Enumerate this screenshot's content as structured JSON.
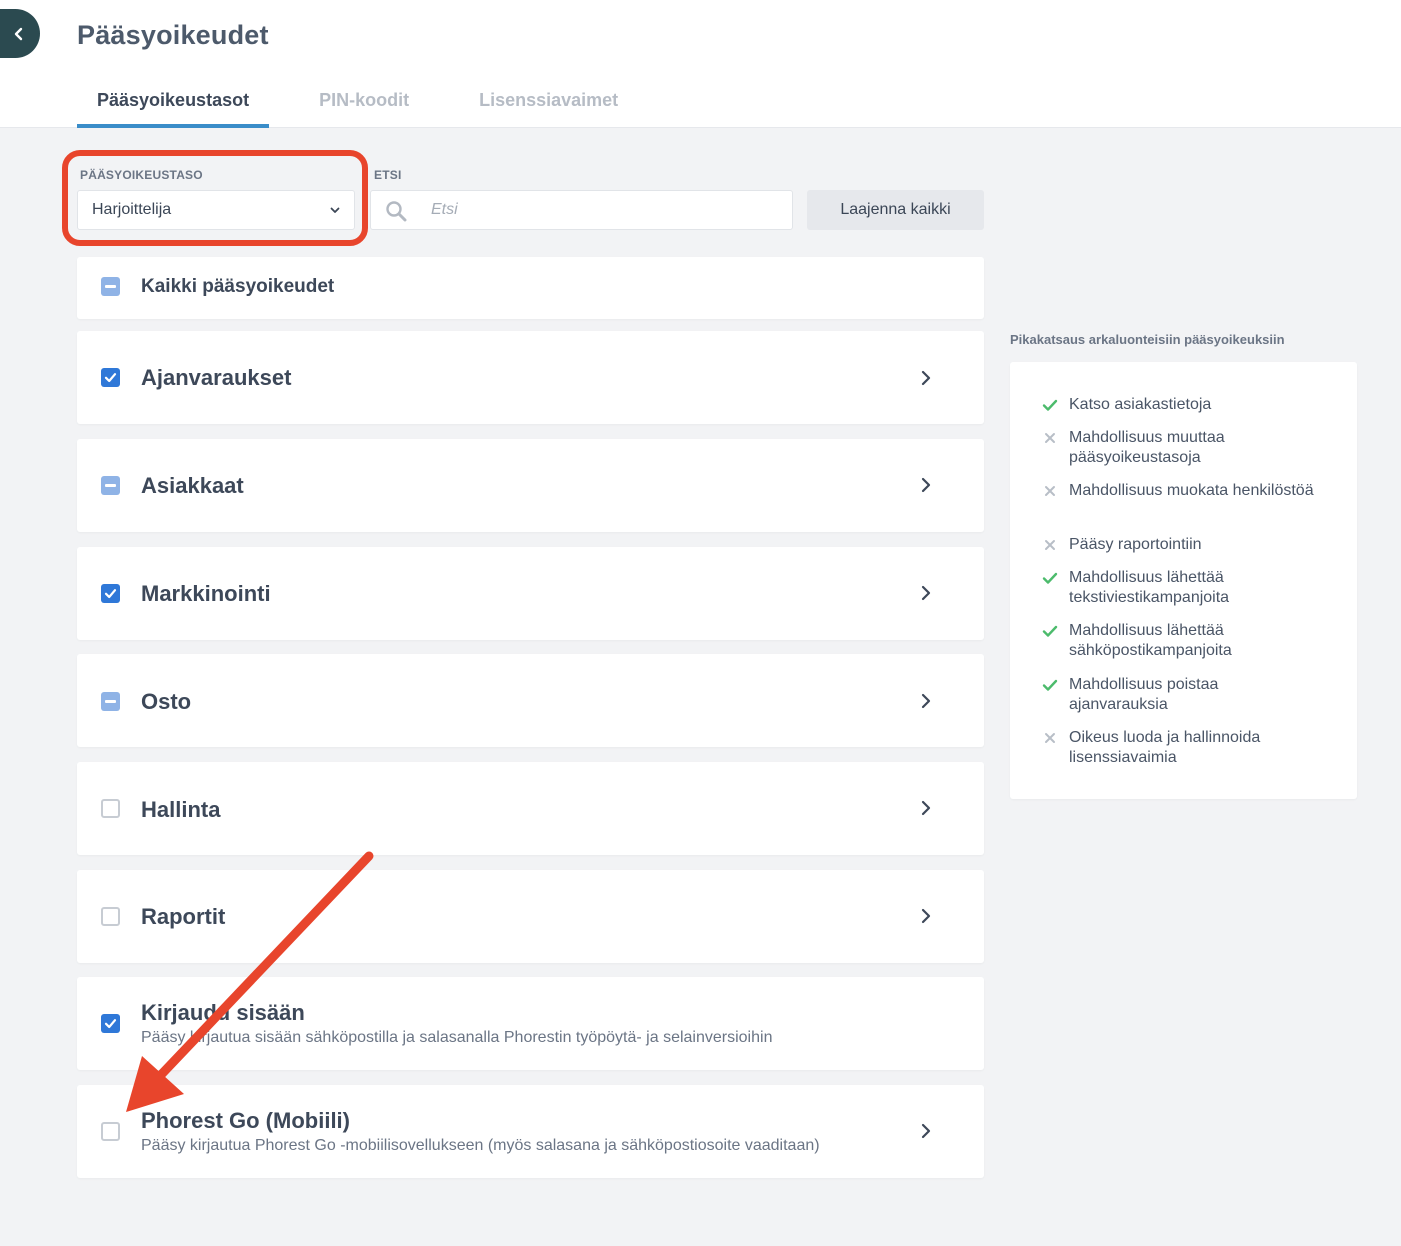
{
  "page": {
    "title": "Pääsyoikeudet"
  },
  "tabs": [
    {
      "label": "Pääsyoikeustasot",
      "active": true
    },
    {
      "label": "PIN-koodit",
      "active": false
    },
    {
      "label": "Lisenssiavaimet",
      "active": false
    }
  ],
  "filters": {
    "level_label": "PÄÄSYOIKEUSTASO",
    "level_value": "Harjoittelija",
    "search_label": "ETSI",
    "search_placeholder": "Etsi",
    "search_value": "",
    "expand_all_label": "Laajenna kaikki"
  },
  "all_permissions": {
    "label": "Kaikki pääsyoikeudet",
    "state": "partial"
  },
  "categories": [
    {
      "label": "Ajanvaraukset",
      "state": "checked",
      "expandable": true
    },
    {
      "label": "Asiakkaat",
      "state": "partial",
      "expandable": true
    },
    {
      "label": "Markkinointi",
      "state": "checked",
      "expandable": true
    },
    {
      "label": "Osto",
      "state": "partial",
      "expandable": true
    },
    {
      "label": "Hallinta",
      "state": "empty",
      "expandable": true
    },
    {
      "label": "Raportit",
      "state": "empty",
      "expandable": true
    },
    {
      "label": "Kirjaudu sisään",
      "description": "Pääsy kirjautua sisään sähköpostilla ja salasanalla Phorestin työpöytä- ja selainversioihin",
      "state": "checked",
      "expandable": false
    },
    {
      "label": "Phorest Go (Mobiili)",
      "description": "Pääsy kirjautua Phorest Go -mobiilisovellukseen (myös salasana ja sähköpostiosoite vaaditaan)",
      "state": "empty",
      "expandable": true
    }
  ],
  "overview": {
    "title": "Pikakatsaus arkaluonteisiin pääsyoikeuksiin",
    "items": [
      {
        "text": "Katso asiakastietoja",
        "allowed": true
      },
      {
        "text": "Mahdollisuus muuttaa pääsyoikeustasoja",
        "allowed": false
      },
      {
        "text": "Mahdollisuus muokata henkilöstöä",
        "allowed": false
      },
      {
        "text": "Pääsy raportointiin",
        "allowed": false
      },
      {
        "text": "Mahdollisuus lähettää tekstiviestikampanjoita",
        "allowed": true
      },
      {
        "text": "Mahdollisuus lähettää sähköpostikampanjoita",
        "allowed": true
      },
      {
        "text": "Mahdollisuus poistaa ajanvarauksia",
        "allowed": true
      },
      {
        "text": "Oikeus luoda ja hallinnoida lisenssiavaimia",
        "allowed": false
      }
    ]
  },
  "colors": {
    "accent": "#3a8dc9",
    "checkbox_checked": "#2f78d8",
    "checkbox_partial": "#8fb3e6",
    "allowed": "#4cbb6c",
    "denied": "#b8bec7",
    "annotation": "#e8452c",
    "back_button": "#2b4a50"
  },
  "icons": {
    "back": "chevron-left-icon",
    "select": "chevron-down-icon",
    "search": "search-icon",
    "expand": "chevron-right-icon",
    "allowed": "check-icon",
    "denied": "x-icon"
  }
}
